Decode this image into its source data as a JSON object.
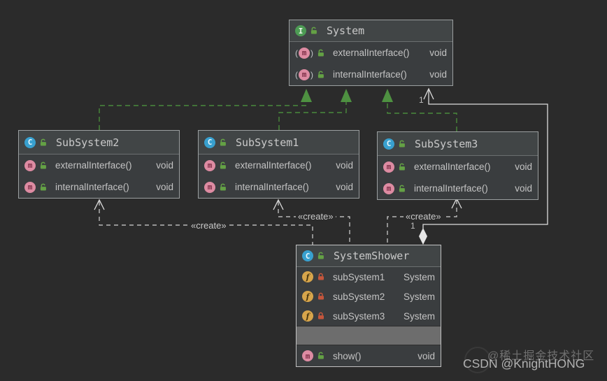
{
  "app": {
    "watermark_line1": "@稀土掘金技术社区",
    "watermark_line2": "CSDN @KnightHONG"
  },
  "colors": {
    "background": "#2b2b2b",
    "box_background": "#3a3d3f",
    "box_header_background": "#414546",
    "box_border": "#9b9fa0",
    "member_text": "#c4c4c4",
    "realization_green": "#4e9141",
    "edge_white": "#dcdcdc",
    "public_lock_green": "#64a145",
    "private_lock_red": "#c4563c",
    "class_icon_blue": "#38a0cf",
    "interface_icon_green": "#4d9b54",
    "method_icon_pink": "#dd8ba2",
    "field_icon_yellow": "#d7a54b",
    "separator_gray": "#6d6d6d"
  },
  "classes": [
    {
      "title": "System",
      "kind": "interface",
      "icon_letter": "I",
      "members": [
        {
          "icon": "m",
          "name": "externalInterface()",
          "type": "void"
        },
        {
          "icon": "m",
          "name": "internalInterface()",
          "type": "void"
        }
      ]
    },
    {
      "title": "SubSystem2",
      "kind": "class",
      "icon_letter": "C",
      "members": [
        {
          "icon": "m",
          "name": "externalInterface()",
          "type": "void"
        },
        {
          "icon": "m",
          "name": "internalInterface()",
          "type": "void"
        }
      ]
    },
    {
      "title": "SubSystem1",
      "kind": "class",
      "icon_letter": "C",
      "members": [
        {
          "icon": "m",
          "name": "externalInterface()",
          "type": "void"
        },
        {
          "icon": "m",
          "name": "internalInterface()",
          "type": "void"
        }
      ]
    },
    {
      "title": "SubSystem3",
      "kind": "class",
      "icon_letter": "C",
      "members": [
        {
          "icon": "m",
          "name": "externalInterface()",
          "type": "void"
        },
        {
          "icon": "m",
          "name": "internalInterface()",
          "type": "void"
        }
      ]
    },
    {
      "title": "SystemShower",
      "kind": "class",
      "icon_letter": "C",
      "members": [
        {
          "icon": "f",
          "name": "subSystem1",
          "type": "System"
        },
        {
          "icon": "f",
          "name": "subSystem2",
          "type": "System"
        },
        {
          "icon": "f",
          "name": "subSystem3",
          "type": "System"
        },
        {
          "icon": "m",
          "name": "show()",
          "type": "void"
        }
      ]
    }
  ],
  "edges": {
    "create_label": "«create»",
    "aggregation_target_multiplicity": "1",
    "aggregation_source_multiplicity": "1"
  }
}
